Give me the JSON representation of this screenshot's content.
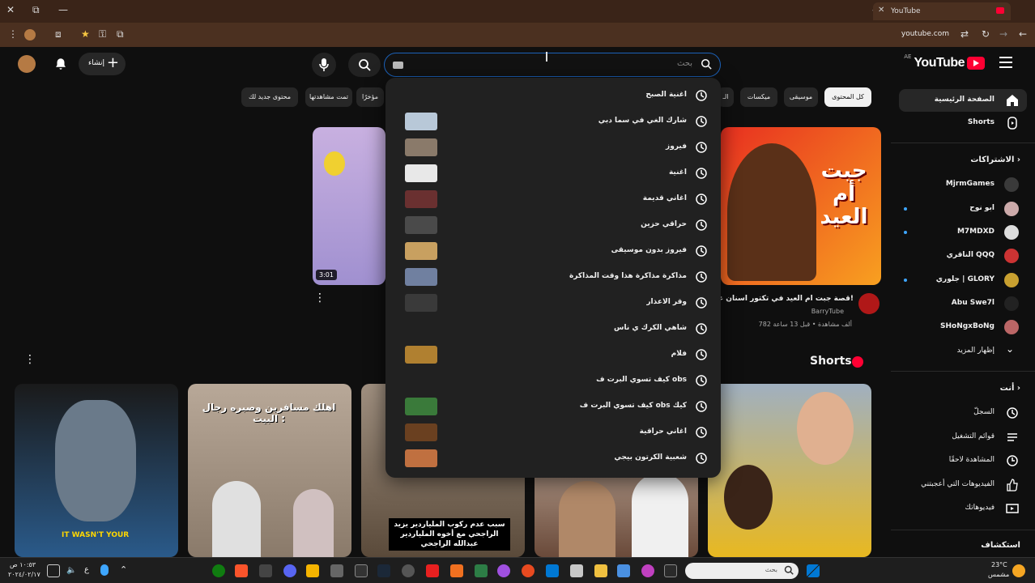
{
  "browser": {
    "tab_title": "YouTube",
    "url": "youtube.com"
  },
  "header": {
    "logo_text": "YouTube",
    "country_code": "AE",
    "search_placeholder": "بحث",
    "create_label": "إنشاء"
  },
  "chips": [
    "كل المحتوى",
    "موسيقى",
    "ميكسات",
    "الـ",
    "مؤخرًا",
    "تمت مشاهدتها",
    "محتوى جديد لك"
  ],
  "sidebar": {
    "main": [
      {
        "label": "الصفحة الرئيسية",
        "icon": "home-icon"
      },
      {
        "label": "Shorts",
        "icon": "shorts-icon"
      }
    ],
    "subs_header": "الاشتراكات",
    "subscriptions": [
      {
        "label": "MjrmGames",
        "color": "#3a3a3a",
        "dot": false
      },
      {
        "label": "ابو نوح",
        "color": "#caa",
        "dot": true
      },
      {
        "label": "M7MDXD",
        "color": "#ddd",
        "dot": true
      },
      {
        "label": "الناقري QQQ",
        "color": "#c33",
        "dot": false
      },
      {
        "label": "جلوري | GLORY",
        "color": "#c8a030",
        "dot": true
      },
      {
        "label": "Abu Swe7l",
        "color": "#222",
        "dot": false
      },
      {
        "label": "SHoNgxBoNg",
        "color": "#b66",
        "dot": false
      }
    ],
    "show_more": "إظهار المزيد",
    "you_header": "أنت",
    "you_items": [
      {
        "label": "السجلّ",
        "icon": "history-icon"
      },
      {
        "label": "قوائم التشغيل",
        "icon": "playlist-icon"
      },
      {
        "label": "المشاهدة لاحقًا",
        "icon": "clock-icon"
      },
      {
        "label": "الفيديوهات التي أعجبتني",
        "icon": "thumb-up-icon"
      },
      {
        "label": "فيديوهاتك",
        "icon": "your-videos-icon"
      }
    ],
    "explore_header": "استكشاف"
  },
  "featured": {
    "title": "قصة جبت ام العيد في تكتور اسنان عالي!",
    "channel": "BarryTube",
    "meta": "782 ألف مشاهدة • قبل 13 ساعة",
    "thumb_text": "جبت أم العيد",
    "duration": "3:01"
  },
  "suggestions": [
    {
      "text": "اغنية الصبح",
      "thumb": null
    },
    {
      "text": "شارك الغي في سما دبي",
      "thumb": "#b8c8d8"
    },
    {
      "text": "فيروز",
      "thumb": "#8a7a6a"
    },
    {
      "text": "اغنية",
      "thumb": "#e8e8e8"
    },
    {
      "text": "اغاني قديمة",
      "thumb": "#6a3030"
    },
    {
      "text": "حراقي حزين",
      "thumb": "#4a4a4a"
    },
    {
      "text": "فيروز بدون موسيقى",
      "thumb": "#c8a060"
    },
    {
      "text": "مذاكرة مذاكرة هذا وقت المذاكرة",
      "thumb": "#7080a0"
    },
    {
      "text": "وقر الاعذار",
      "thumb": "#3a3a3a"
    },
    {
      "text": "شاهي الكرك ي ناس",
      "thumb": null
    },
    {
      "text": "فلام",
      "thumb": "#b08030"
    },
    {
      "text": "كيف تسوي البرت ف obs",
      "thumb": null
    },
    {
      "text": "كيف تسوي البرت ف obs كيك",
      "thumb": "#3a7a3a"
    },
    {
      "text": "اغاني حراقية",
      "thumb": "#6a4020"
    },
    {
      "text": "شعبية الكرتون بيجي",
      "thumb": "#c07040"
    }
  ],
  "shorts": {
    "heading": "Shorts",
    "items": [
      {
        "overlay": "IT WASN'T YOUR",
        "color": "#2a4a6a"
      },
      {
        "overlay": "اهلك مسافرين وصبره رجال البيت :",
        "color": "#7a6a5a"
      },
      {
        "overlay": "سبب عدم ركوب الملياردير يزيد الراجحي مع أخوه الملياردير عبدالله الراجحي",
        "color": "#6a5a4a"
      },
      {
        "overlay": "",
        "color": "#6a4a3a"
      },
      {
        "overlay": "",
        "color": "#c8a020"
      }
    ]
  },
  "taskbar": {
    "search_placeholder": "بحث",
    "weather_temp": "23°C",
    "weather_desc": "مشمس",
    "time": "١٠:٥٣ ص",
    "date": "٢٠٢٤/٠٢/١٧",
    "lang": "ع"
  }
}
